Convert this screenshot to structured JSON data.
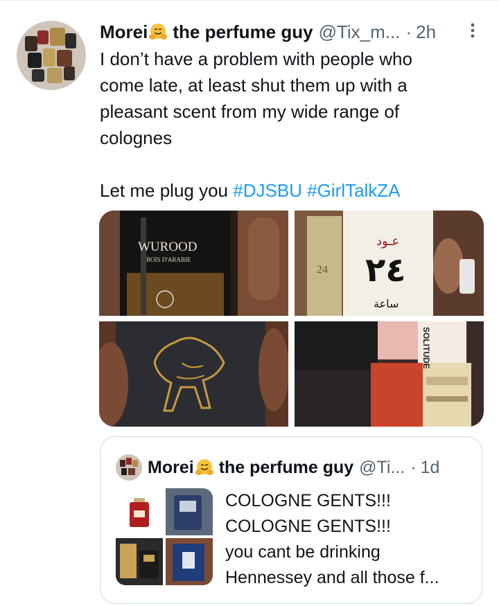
{
  "tweet": {
    "display_name": "Morei",
    "display_name_suffix": "the perfume guy",
    "handle": "@Tix_m...",
    "separator": "·",
    "time": "2h",
    "text_lines": [
      "I don’t have a problem with people who",
      "come late, at least shut them up with a",
      "pleasant scent from my wide range of",
      "colognes"
    ],
    "plug_text": "Let me plug you ",
    "hashtags": [
      "#DJSBU",
      "#GirlTalkZA"
    ],
    "media": {
      "img1_text_top": "WUROOD",
      "img1_text_sub": "BOIS D'ARABIE",
      "img2_arabic_top": "عـود",
      "img2_arabic_num": "٢٤",
      "img2_arabic_bottom": "ساعة",
      "img2_num_side": "24",
      "img4_label": "SOLITUDE"
    }
  },
  "quoted": {
    "display_name": "Morei",
    "display_name_suffix": "the perfume guy",
    "handle": "@Ti...",
    "separator": "·",
    "time": "1d",
    "text_lines": [
      "COLOGNE GENTS!!!",
      "COLOGNE GENTS!!!",
      "you cant be drinking",
      "Hennessey and all those f..."
    ]
  },
  "colors": {
    "link": "#1d9bf0",
    "secondary": "#536471",
    "border": "#cfd9de"
  },
  "icons": {
    "hugging_face": "hugging-face-emoji",
    "more": "more-dots-icon"
  }
}
